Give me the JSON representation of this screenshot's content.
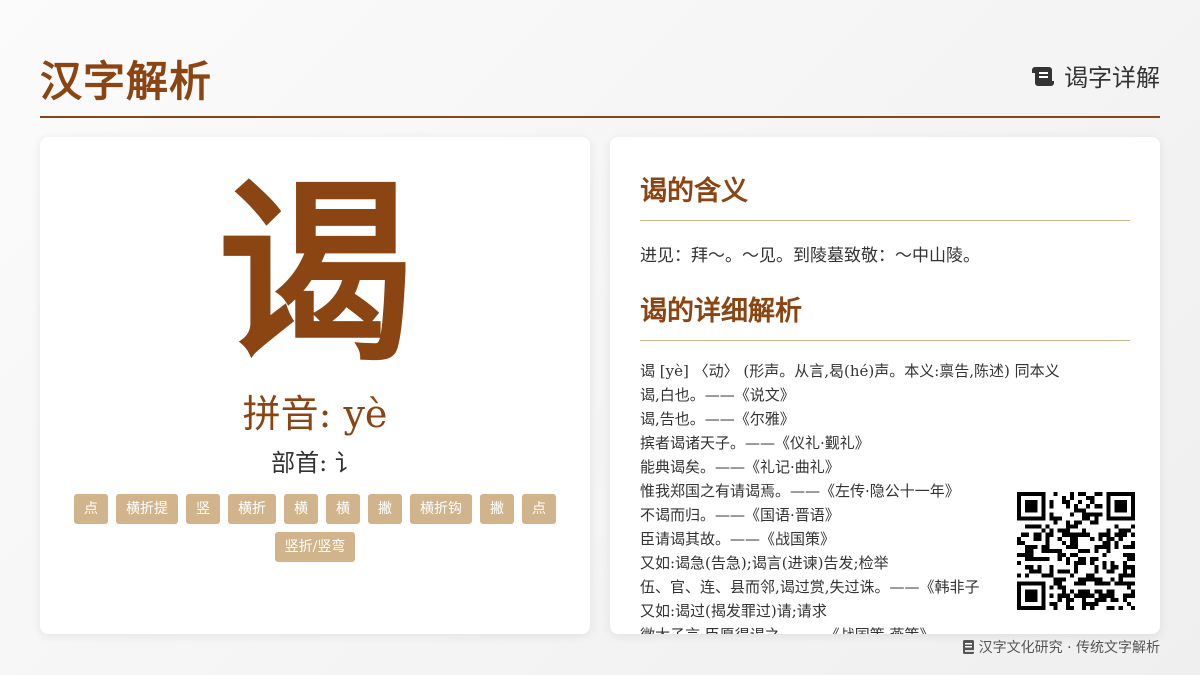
{
  "header": {
    "title": "汉字解析",
    "right_label": "谒字详解",
    "right_icon": "scroll-icon"
  },
  "character": {
    "glyph": "谒",
    "pinyin": "拼音: yè",
    "radical": "部首: 讠",
    "strokes": [
      "点",
      "横折提",
      "竖",
      "横折",
      "横",
      "横",
      "撇",
      "横折钩",
      "撇",
      "点",
      "竖折/竖弯"
    ]
  },
  "meaning": {
    "title": "谒的含义",
    "text": "进见：拜～。～见。到陵墓致敬：～中山陵。"
  },
  "detail": {
    "title": "谒的详细解析",
    "lines": [
      "谒 [yè] 〈动〉 (形声。从言,曷(hé)声。本义:禀告,陈述) 同本义",
      "谒,白也。——《说文》",
      "谒,告也。——《尔雅》",
      "摈者谒诸天子。——《仪礼·觐礼》",
      "能典谒矣。——《礼记·曲礼》",
      "惟我郑国之有请谒焉。——《左传·隐公十一年》",
      "不谒而归。——《国语·晋语》",
      "臣请谒其故。——《战国策》",
      "又如:谒急(告急);谒言(进谏)告发;检举",
      "伍、官、连、县而邻,谒过赏,失过诛。——《韩非子",
      "又如:谒过(揭发罪过)请;请求",
      "微太子言,臣愿得谒之。——《战国策·燕策》"
    ]
  },
  "footer": {
    "text": "汉字文化研究 · 传统文字解析",
    "icon": "book-icon"
  },
  "colors": {
    "accent": "#8b4513",
    "stroke_tag": "#d2b48c",
    "divider": "#d2b48c"
  }
}
